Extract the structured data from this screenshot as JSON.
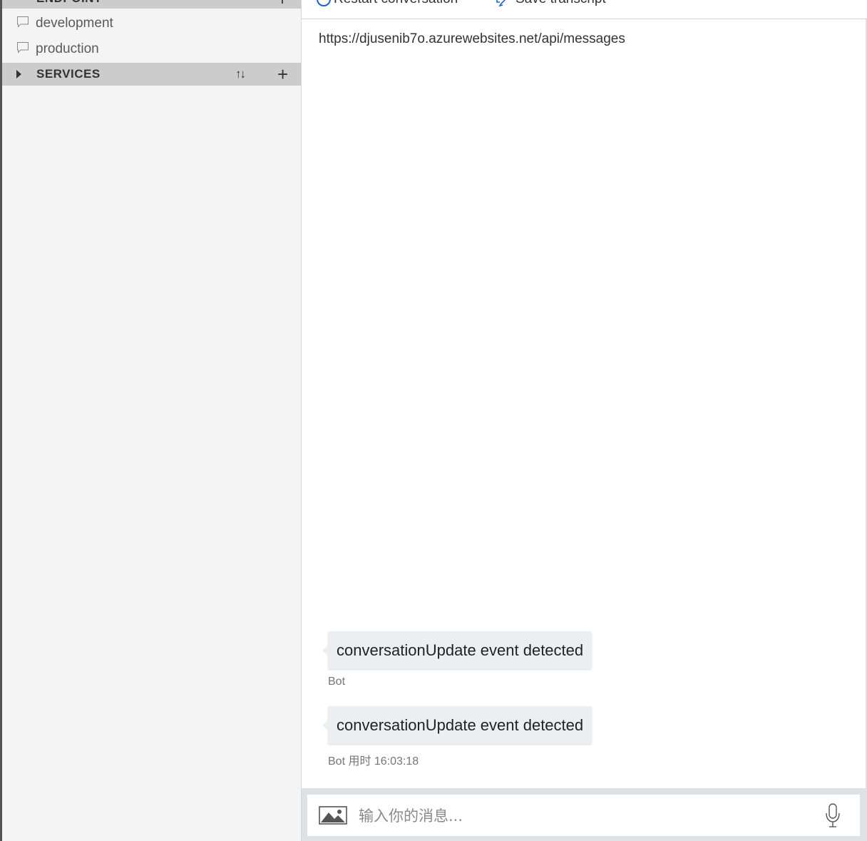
{
  "sidebar": {
    "top_section_label": "ENDPOINT",
    "endpoints": [
      {
        "name": "development",
        "icon": "chat-icon"
      },
      {
        "name": "production",
        "icon": "chat-icon"
      }
    ],
    "services_label": "SERVICES",
    "sort_glyph": "↑↓",
    "add_glyph": "+"
  },
  "toolbar": {
    "restart_label": "Restart conversation",
    "save_label": "Save transcript"
  },
  "chat": {
    "endpoint_url": "https://djusenib7o.azurewebsites.net/api/messages",
    "messages": [
      {
        "text": "conversationUpdate event detected",
        "meta": "Bot"
      },
      {
        "text": "conversationUpdate event detected",
        "meta": "Bot 用时 16:03:18"
      }
    ]
  },
  "input": {
    "placeholder": "输入你的消息..."
  },
  "colors": {
    "accent": "#1e5fcf",
    "sidebar_bg": "#f4f4f4",
    "section_header_bg": "#cccccc",
    "bubble_bg": "#eceff1",
    "input_bar_bg": "#dfe2e5"
  }
}
